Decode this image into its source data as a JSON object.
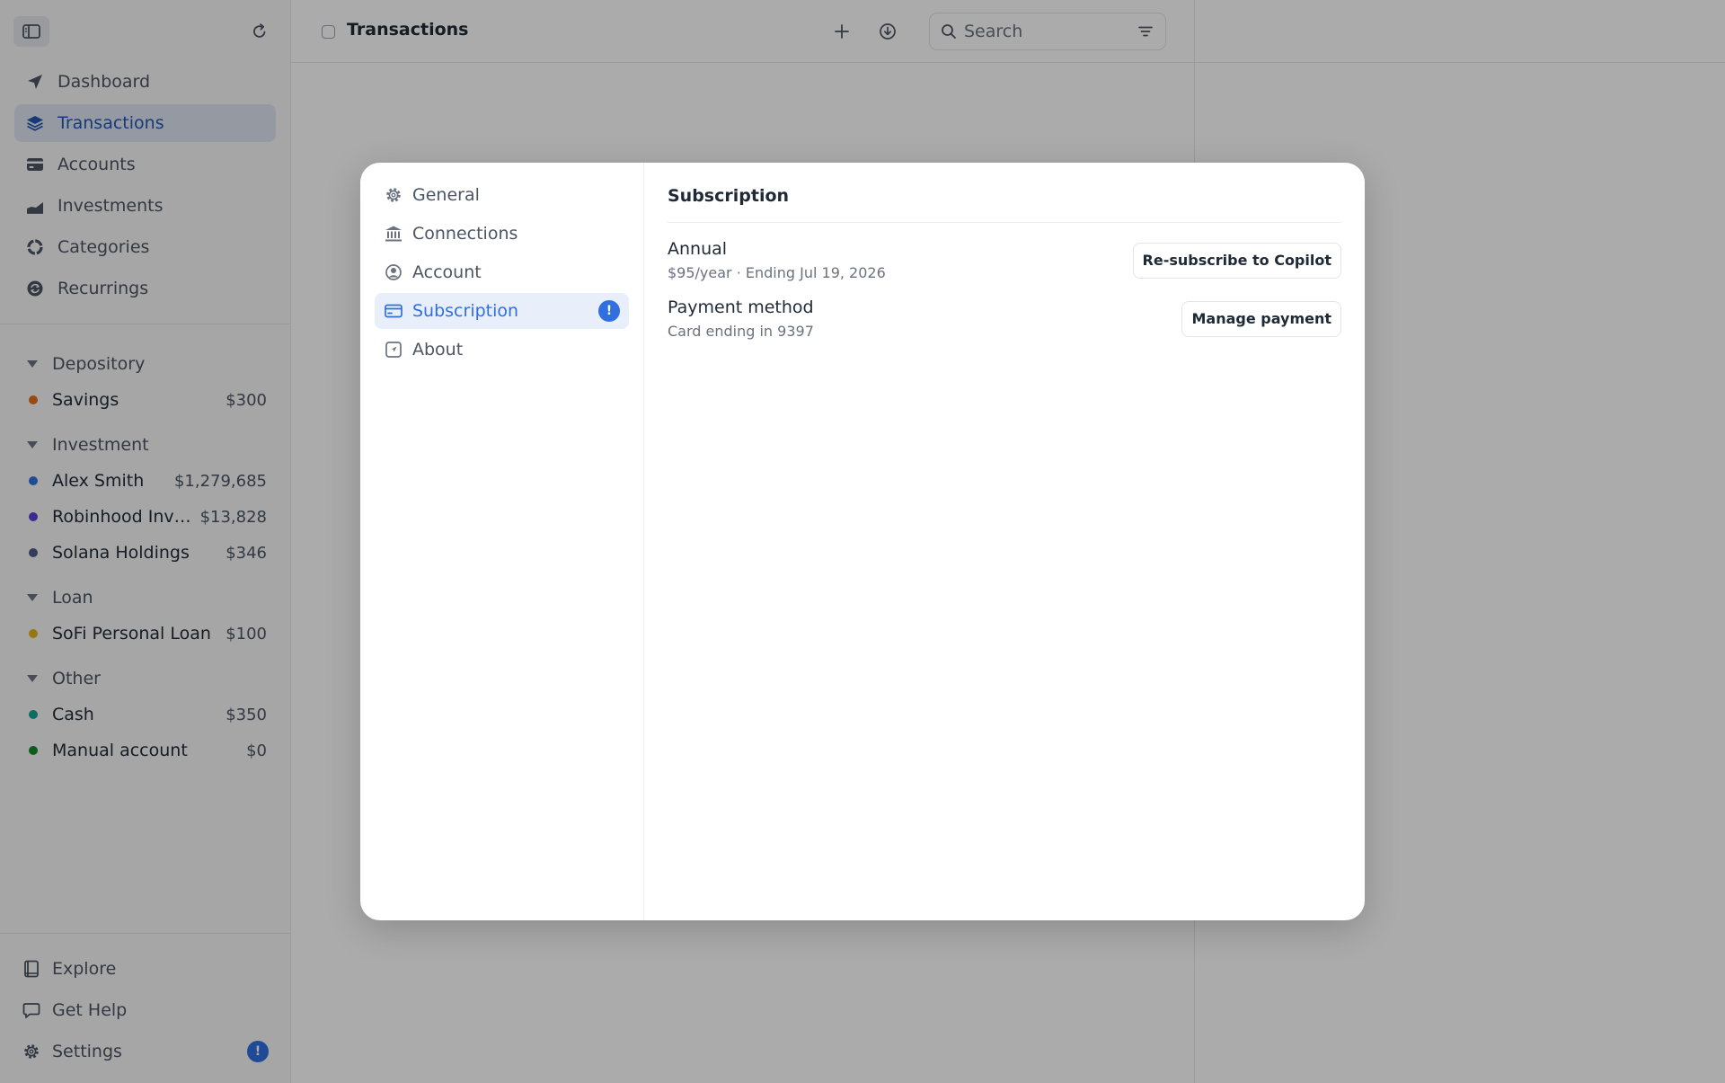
{
  "sidebar": {
    "nav": [
      {
        "label": "Dashboard",
        "icon": "paper-plane-icon",
        "active": false
      },
      {
        "label": "Transactions",
        "icon": "layers-icon",
        "active": true
      },
      {
        "label": "Accounts",
        "icon": "card-icon",
        "active": false
      },
      {
        "label": "Investments",
        "icon": "chart-icon",
        "active": false
      },
      {
        "label": "Categories",
        "icon": "pie-icon",
        "active": false
      },
      {
        "label": "Recurrings",
        "icon": "recurring-icon",
        "active": false
      }
    ],
    "groups": [
      {
        "title": "Depository",
        "accounts": [
          {
            "name": "Savings",
            "amount": "$300",
            "color": "#e2711d"
          }
        ]
      },
      {
        "title": "Investment",
        "accounts": [
          {
            "name": "Alex Smith",
            "amount": "$1,279,685",
            "color": "#2f6fe0"
          },
          {
            "name": "Robinhood Inves...",
            "amount": "$13,828",
            "color": "#5b3fd6"
          },
          {
            "name": "Solana Holdings",
            "amount": "$346",
            "color": "#4b5a8a"
          }
        ]
      },
      {
        "title": "Loan",
        "accounts": [
          {
            "name": "SoFi Personal Loan",
            "amount": "$100",
            "color": "#e3b21a"
          }
        ]
      },
      {
        "title": "Other",
        "accounts": [
          {
            "name": "Cash",
            "amount": "$350",
            "color": "#16a394"
          },
          {
            "name": "Manual account",
            "amount": "$0",
            "color": "#138a2a"
          }
        ]
      }
    ],
    "bottom": [
      {
        "label": "Explore",
        "icon": "book-icon"
      },
      {
        "label": "Get Help",
        "icon": "chat-bubble-icon"
      },
      {
        "label": "Settings",
        "icon": "gear-icon",
        "badge": "!"
      }
    ]
  },
  "topbar": {
    "title": "Transactions",
    "search_placeholder": "Search"
  },
  "modal": {
    "nav": [
      {
        "label": "General",
        "icon": "gear-icon"
      },
      {
        "label": "Connections",
        "icon": "bank-icon"
      },
      {
        "label": "Account",
        "icon": "user-circle-icon"
      },
      {
        "label": "Subscription",
        "icon": "credit-card-icon",
        "active": true,
        "badge": "!"
      },
      {
        "label": "About",
        "icon": "about-icon"
      }
    ],
    "title": "Subscription",
    "plan": {
      "label": "Annual",
      "detail": "$95/year · Ending Jul 19, 2026",
      "button": "Re-subscribe to Copilot"
    },
    "payment": {
      "label": "Payment method",
      "detail": "Card ending in 9397",
      "button": "Manage payment"
    }
  },
  "colors": {
    "accent": "#2f6fe0",
    "active_nav_bg": "#dfe6f2",
    "overlay": "rgba(0,0,0,0.33)"
  }
}
